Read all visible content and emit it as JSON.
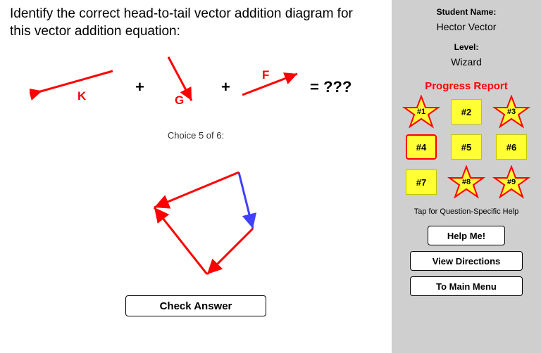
{
  "prompt": "Identify the correct head-to-tail vector addition diagram for this vector addition equation:",
  "equation": {
    "vectors": [
      "K",
      "G",
      "F"
    ],
    "plus": "+",
    "equals": "= ???"
  },
  "choice_label": "Choice 5 of 6:",
  "check_button": "Check Answer",
  "sidebar": {
    "name_label": "Student Name:",
    "name_value": "Hector Vector",
    "level_label": "Level:",
    "level_value": "Wizard",
    "progress_title": "Progress Report",
    "cells": [
      {
        "label": "#1",
        "star": true,
        "current": false
      },
      {
        "label": "#2",
        "star": false,
        "current": false
      },
      {
        "label": "#3",
        "star": true,
        "current": false
      },
      {
        "label": "#4",
        "star": false,
        "current": true
      },
      {
        "label": "#5",
        "star": false,
        "current": false
      },
      {
        "label": "#6",
        "star": false,
        "current": false
      },
      {
        "label": "#7",
        "star": false,
        "current": false
      },
      {
        "label": "#8",
        "star": true,
        "current": false
      },
      {
        "label": "#9",
        "star": true,
        "current": false
      }
    ],
    "hint": "Tap for Question-Specific Help",
    "help_button": "Help Me!",
    "directions_button": "View Directions",
    "menu_button": "To Main Menu"
  }
}
